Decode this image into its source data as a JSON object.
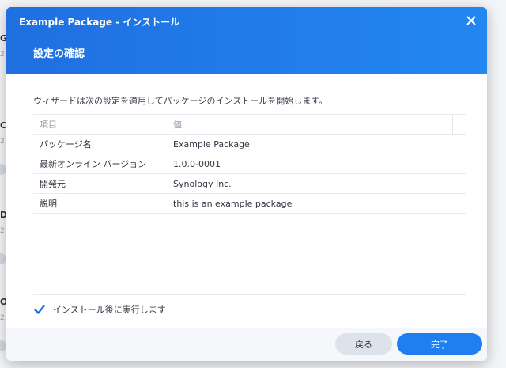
{
  "background": {
    "letters": [
      "G",
      "C",
      "D",
      "O"
    ],
    "sub": "2"
  },
  "dialog": {
    "window_title": "Example Package - インストール",
    "step_title": "設定の確認",
    "intro": "ウィザードは次の設定を適用してパッケージのインストールを開始します。",
    "table": {
      "headers": [
        "項目",
        "値"
      ],
      "rows": [
        {
          "item": "パッケージ名",
          "value": "Example Package"
        },
        {
          "item": "最新オンライン バージョン",
          "value": "1.0.0-0001"
        },
        {
          "item": "開発元",
          "value": "Synology Inc."
        },
        {
          "item": "説明",
          "value": "this is an example package"
        }
      ]
    },
    "run_after_install": {
      "label": "インストール後に実行します",
      "checked": true
    },
    "buttons": {
      "back": "戻る",
      "finish": "完了"
    }
  },
  "colors": {
    "header_blue": "#1f7ff0",
    "checkbox_blue": "#1f6fe0"
  },
  "icons": {
    "close": "close-icon",
    "check": "checkmark-icon"
  }
}
